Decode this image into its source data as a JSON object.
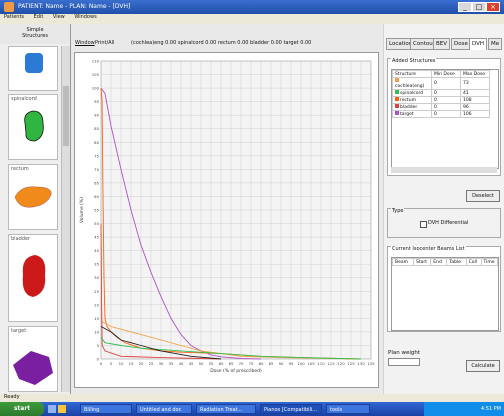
{
  "window": {
    "title": "PATIENT: Name - PLAN: Name - [DVH]",
    "minimize": "_",
    "maximize": "□",
    "close": "×"
  },
  "menu": [
    "Patients",
    "Edit",
    "View",
    "Windows"
  ],
  "left_panel": {
    "header": "Simple Structures",
    "structures": [
      {
        "label": "",
        "color": "#2a7ad6"
      },
      {
        "label": "spinalcord",
        "color": "#2fb540"
      },
      {
        "label": "rectum",
        "color": "#f08a1a"
      },
      {
        "label": "bladder",
        "color": "#cc1a1a"
      },
      {
        "label": "target",
        "color": "#7a1fa0"
      }
    ]
  },
  "center": {
    "toolbar": {
      "view_label": "Window",
      "print_label": "Print/All",
      "info": "(cochlea)eng 0.00 spinalcord 0.00 rectum 0.00 bladder 0.00 target 0.00"
    },
    "chart_title": ""
  },
  "chart_data": {
    "type": "line",
    "title": "",
    "xlabel": "Dose (% of prescribed)",
    "ylabel": "Volume (%)",
    "xlim": [
      0,
      135
    ],
    "ylim": [
      0,
      110
    ],
    "x_ticks": [
      0,
      5,
      10,
      15,
      20,
      25,
      30,
      35,
      40,
      45,
      50,
      55,
      60,
      65,
      70,
      75,
      80,
      85,
      90,
      95,
      100,
      105,
      110,
      115,
      120,
      125,
      130,
      135
    ],
    "y_ticks": [
      0,
      5,
      10,
      15,
      20,
      25,
      30,
      35,
      40,
      45,
      50,
      55,
      60,
      65,
      70,
      75,
      80,
      85,
      90,
      95,
      100,
      105,
      110
    ],
    "grid": true,
    "series": [
      {
        "color": "#b050c8",
        "points": [
          [
            0,
            100
          ],
          [
            2,
            98
          ],
          [
            5,
            86
          ],
          [
            10,
            70
          ],
          [
            15,
            55
          ],
          [
            20,
            42
          ],
          [
            25,
            32
          ],
          [
            30,
            23
          ],
          [
            35,
            15
          ],
          [
            40,
            9
          ],
          [
            45,
            5
          ],
          [
            50,
            3
          ],
          [
            55,
            1.5
          ],
          [
            60,
            0.8
          ],
          [
            70,
            0.2
          ],
          [
            80,
            0
          ]
        ]
      },
      {
        "color": "#ff6010",
        "points": [
          [
            0,
            100
          ],
          [
            0.5,
            96
          ],
          [
            1,
            60
          ],
          [
            1.5,
            30
          ],
          [
            2,
            15
          ],
          [
            3,
            12
          ],
          [
            5,
            10
          ],
          [
            8,
            8
          ],
          [
            12,
            6
          ],
          [
            20,
            4
          ],
          [
            30,
            3
          ],
          [
            40,
            2.5
          ],
          [
            60,
            2
          ],
          [
            80,
            1
          ],
          [
            100,
            0.5
          ],
          [
            130,
            0
          ]
        ]
      },
      {
        "color": "#f0a040",
        "points": [
          [
            0,
            14
          ],
          [
            5,
            12
          ],
          [
            10,
            11
          ],
          [
            20,
            9
          ],
          [
            30,
            7
          ],
          [
            40,
            5
          ],
          [
            50,
            3
          ],
          [
            60,
            2
          ],
          [
            70,
            1
          ],
          [
            90,
            0.5
          ],
          [
            130,
            0
          ]
        ]
      },
      {
        "color": "#e04040",
        "points": [
          [
            0,
            50
          ],
          [
            0.3,
            20
          ],
          [
            0.6,
            5
          ],
          [
            2,
            3
          ],
          [
            10,
            1
          ],
          [
            30,
            0.5
          ],
          [
            60,
            0
          ]
        ]
      },
      {
        "color": "#30c050",
        "points": [
          [
            0,
            8
          ],
          [
            2,
            6
          ],
          [
            10,
            5
          ],
          [
            20,
            4
          ],
          [
            40,
            3
          ],
          [
            60,
            2
          ],
          [
            80,
            1
          ],
          [
            100,
            0.5
          ],
          [
            130,
            0
          ]
        ]
      },
      {
        "color": "#202020",
        "points": [
          [
            0,
            12
          ],
          [
            5,
            10
          ],
          [
            10,
            7
          ],
          [
            20,
            5
          ],
          [
            30,
            3
          ],
          [
            45,
            1
          ],
          [
            60,
            0
          ]
        ]
      }
    ]
  },
  "right_panel": {
    "tabs": [
      "Location",
      "Contour",
      "BEV",
      "Dose",
      "DVH",
      "Me"
    ],
    "active_tab": "DVH",
    "added_structures": {
      "title": "Added Structures",
      "headers": [
        "Structure",
        "Min Dose",
        "Max Dose"
      ],
      "rows": [
        {
          "name": "cochlea(eng)",
          "min": "0",
          "max": "73",
          "color": "#f0a040"
        },
        {
          "name": "spinalcord",
          "min": "0",
          "max": "41",
          "color": "#30c050"
        },
        {
          "name": "rectum",
          "min": "0",
          "max": "108",
          "color": "#ff6010"
        },
        {
          "name": "bladder",
          "min": "0",
          "max": "96",
          "color": "#e04040"
        },
        {
          "name": "target",
          "min": "0",
          "max": "106",
          "color": "#b050c8"
        }
      ]
    },
    "deselect_label": "Deselect",
    "type_label": "Type",
    "differential_label": "DVH Differential",
    "beams": {
      "title": "Current Isocenter Beams List",
      "headers": [
        "Beam",
        "Start",
        "End",
        "Table",
        "Coll",
        "Time"
      ]
    },
    "plan_weight_label": "Plan weight",
    "calculate_label": "Calculate"
  },
  "status": {
    "text": "Ready"
  },
  "taskbar": {
    "start_label": "start",
    "items": [
      "Billing",
      "Untitled and doc",
      "Radiation Treat...",
      "Pianox [Compatibili...",
      "tools"
    ],
    "clock": "4:51 PM"
  }
}
